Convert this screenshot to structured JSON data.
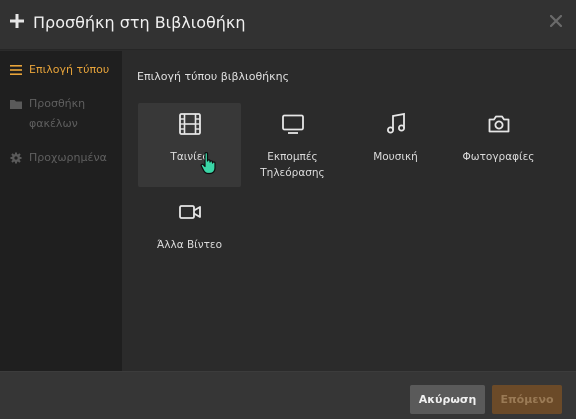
{
  "dialog": {
    "title": "Προσθήκη στη Βιβλιοθήκη"
  },
  "sidebar": {
    "items": [
      {
        "label": "Επιλογή τύπου",
        "icon": "list-icon",
        "state": "active"
      },
      {
        "label": "Προσθήκη φακέλων",
        "icon": "folder-icon",
        "state": "disabled"
      },
      {
        "label": "Προχωρημένα",
        "icon": "gear-icon",
        "state": "disabled"
      }
    ]
  },
  "main": {
    "section_title": "Επιλογή τύπου βιβλιοθήκης",
    "library_types": [
      {
        "label": "Ταινίες",
        "icon": "film-icon"
      },
      {
        "label": "Εκπομπές Τηλεόρασης",
        "icon": "tv-icon"
      },
      {
        "label": "Μουσική",
        "icon": "music-icon"
      },
      {
        "label": "Φωτογραφίες",
        "icon": "camera-icon"
      },
      {
        "label": "Άλλα Βίντεο",
        "icon": "video-camera-icon"
      }
    ]
  },
  "footer": {
    "cancel_label": "Ακύρωση",
    "next_label": "Επόμενο"
  },
  "colors": {
    "accent": "#e8a43a",
    "next_button_disabled": "#6b4a28",
    "cursor": "#3ad6a6"
  }
}
